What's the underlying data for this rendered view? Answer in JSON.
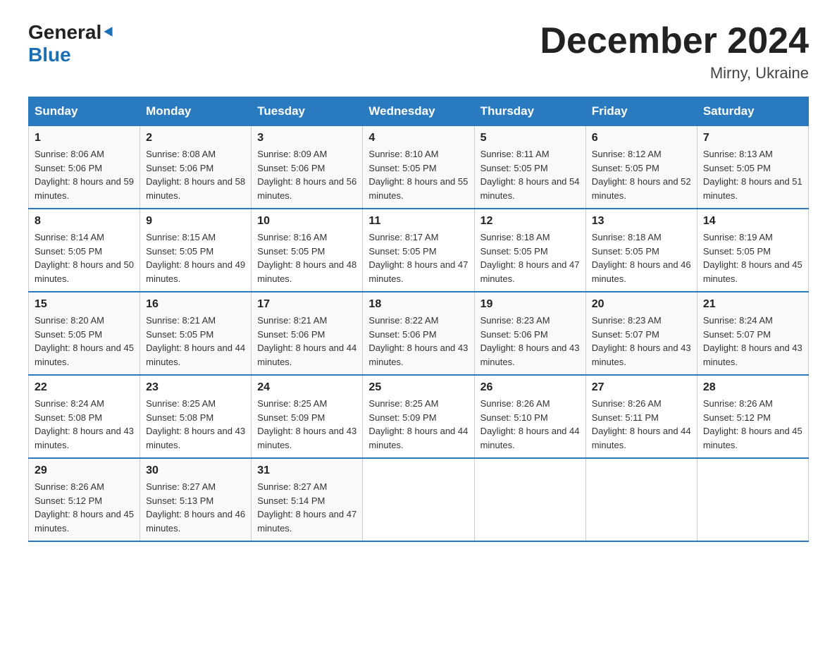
{
  "header": {
    "logo_line1": "General",
    "logo_line2": "Blue",
    "month_title": "December 2024",
    "location": "Mirny, Ukraine"
  },
  "days_of_week": [
    "Sunday",
    "Monday",
    "Tuesday",
    "Wednesday",
    "Thursday",
    "Friday",
    "Saturday"
  ],
  "weeks": [
    [
      {
        "num": "1",
        "sunrise": "8:06 AM",
        "sunset": "5:06 PM",
        "daylight": "8 hours and 59 minutes."
      },
      {
        "num": "2",
        "sunrise": "8:08 AM",
        "sunset": "5:06 PM",
        "daylight": "8 hours and 58 minutes."
      },
      {
        "num": "3",
        "sunrise": "8:09 AM",
        "sunset": "5:06 PM",
        "daylight": "8 hours and 56 minutes."
      },
      {
        "num": "4",
        "sunrise": "8:10 AM",
        "sunset": "5:05 PM",
        "daylight": "8 hours and 55 minutes."
      },
      {
        "num": "5",
        "sunrise": "8:11 AM",
        "sunset": "5:05 PM",
        "daylight": "8 hours and 54 minutes."
      },
      {
        "num": "6",
        "sunrise": "8:12 AM",
        "sunset": "5:05 PM",
        "daylight": "8 hours and 52 minutes."
      },
      {
        "num": "7",
        "sunrise": "8:13 AM",
        "sunset": "5:05 PM",
        "daylight": "8 hours and 51 minutes."
      }
    ],
    [
      {
        "num": "8",
        "sunrise": "8:14 AM",
        "sunset": "5:05 PM",
        "daylight": "8 hours and 50 minutes."
      },
      {
        "num": "9",
        "sunrise": "8:15 AM",
        "sunset": "5:05 PM",
        "daylight": "8 hours and 49 minutes."
      },
      {
        "num": "10",
        "sunrise": "8:16 AM",
        "sunset": "5:05 PM",
        "daylight": "8 hours and 48 minutes."
      },
      {
        "num": "11",
        "sunrise": "8:17 AM",
        "sunset": "5:05 PM",
        "daylight": "8 hours and 47 minutes."
      },
      {
        "num": "12",
        "sunrise": "8:18 AM",
        "sunset": "5:05 PM",
        "daylight": "8 hours and 47 minutes."
      },
      {
        "num": "13",
        "sunrise": "8:18 AM",
        "sunset": "5:05 PM",
        "daylight": "8 hours and 46 minutes."
      },
      {
        "num": "14",
        "sunrise": "8:19 AM",
        "sunset": "5:05 PM",
        "daylight": "8 hours and 45 minutes."
      }
    ],
    [
      {
        "num": "15",
        "sunrise": "8:20 AM",
        "sunset": "5:05 PM",
        "daylight": "8 hours and 45 minutes."
      },
      {
        "num": "16",
        "sunrise": "8:21 AM",
        "sunset": "5:05 PM",
        "daylight": "8 hours and 44 minutes."
      },
      {
        "num": "17",
        "sunrise": "8:21 AM",
        "sunset": "5:06 PM",
        "daylight": "8 hours and 44 minutes."
      },
      {
        "num": "18",
        "sunrise": "8:22 AM",
        "sunset": "5:06 PM",
        "daylight": "8 hours and 43 minutes."
      },
      {
        "num": "19",
        "sunrise": "8:23 AM",
        "sunset": "5:06 PM",
        "daylight": "8 hours and 43 minutes."
      },
      {
        "num": "20",
        "sunrise": "8:23 AM",
        "sunset": "5:07 PM",
        "daylight": "8 hours and 43 minutes."
      },
      {
        "num": "21",
        "sunrise": "8:24 AM",
        "sunset": "5:07 PM",
        "daylight": "8 hours and 43 minutes."
      }
    ],
    [
      {
        "num": "22",
        "sunrise": "8:24 AM",
        "sunset": "5:08 PM",
        "daylight": "8 hours and 43 minutes."
      },
      {
        "num": "23",
        "sunrise": "8:25 AM",
        "sunset": "5:08 PM",
        "daylight": "8 hours and 43 minutes."
      },
      {
        "num": "24",
        "sunrise": "8:25 AM",
        "sunset": "5:09 PM",
        "daylight": "8 hours and 43 minutes."
      },
      {
        "num": "25",
        "sunrise": "8:25 AM",
        "sunset": "5:09 PM",
        "daylight": "8 hours and 44 minutes."
      },
      {
        "num": "26",
        "sunrise": "8:26 AM",
        "sunset": "5:10 PM",
        "daylight": "8 hours and 44 minutes."
      },
      {
        "num": "27",
        "sunrise": "8:26 AM",
        "sunset": "5:11 PM",
        "daylight": "8 hours and 44 minutes."
      },
      {
        "num": "28",
        "sunrise": "8:26 AM",
        "sunset": "5:12 PM",
        "daylight": "8 hours and 45 minutes."
      }
    ],
    [
      {
        "num": "29",
        "sunrise": "8:26 AM",
        "sunset": "5:12 PM",
        "daylight": "8 hours and 45 minutes."
      },
      {
        "num": "30",
        "sunrise": "8:27 AM",
        "sunset": "5:13 PM",
        "daylight": "8 hours and 46 minutes."
      },
      {
        "num": "31",
        "sunrise": "8:27 AM",
        "sunset": "5:14 PM",
        "daylight": "8 hours and 47 minutes."
      },
      null,
      null,
      null,
      null
    ]
  ]
}
